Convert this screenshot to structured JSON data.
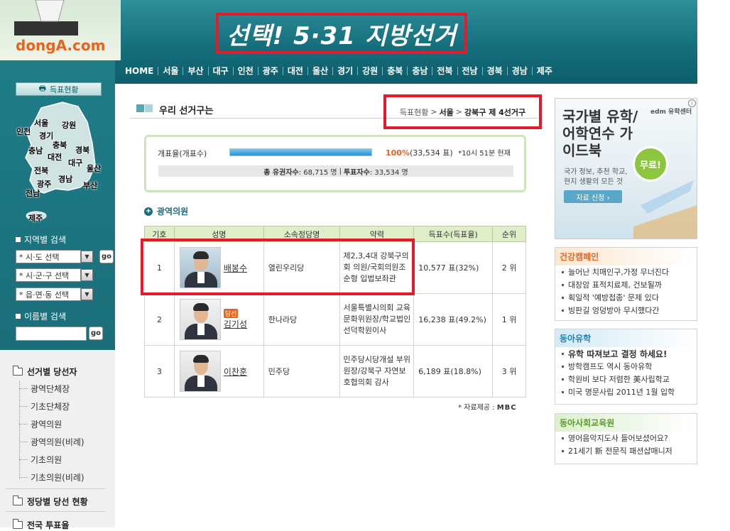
{
  "header": {
    "logo": "dongA.com",
    "banner": "선택! 5·31 지방선거",
    "nav": [
      "HOME",
      "서울",
      "부산",
      "대구",
      "인천",
      "광주",
      "대전",
      "울산",
      "경기",
      "강원",
      "충북",
      "충남",
      "전북",
      "전남",
      "경북",
      "경남",
      "제주"
    ]
  },
  "sidebar": {
    "vote_button": "득표현황",
    "map_regions": [
      "서울",
      "강원",
      "인천",
      "경기",
      "충북",
      "충남",
      "대전",
      "경북",
      "대구",
      "울산",
      "전북",
      "경남",
      "광주",
      "부산",
      "전남",
      "제주"
    ],
    "region_search_label": "지역별 검색",
    "selects": [
      "* 시·도 선택",
      "* 시·군·구 선택",
      "* 읍·면·동 선택"
    ],
    "go": "go",
    "name_search_label": "이름별 검색",
    "tree_title": "선거별 당선자",
    "tree_items": [
      "광역단체장",
      "기초단체장",
      "광역의원",
      "광역의원(비례)",
      "기초의원",
      "기초의원(비례)"
    ],
    "party_title": "정당별 당선 현황",
    "national_title": "전국 투표율"
  },
  "main": {
    "title": "우리 선거구는",
    "breadcrumb": {
      "root": "득표현황",
      "city": "서울",
      "district": "강북구 제 4선거구"
    },
    "summary": {
      "label": "개표율(개표수)",
      "progress": 1.0,
      "percent": "100%",
      "count": "(33,534 표)",
      "time": "*10시 51분 현재",
      "voters_label": "총 유권자수",
      "voters": ": 68,715 명",
      "turnout_label": "투표자수",
      "turnout": ": 33,534 명"
    },
    "section": "광역의원",
    "table": {
      "headers": [
        "기호",
        "성명",
        "소속정당명",
        "약력",
        "득표수(득표율)",
        "순위"
      ],
      "rows": [
        {
          "num": "1",
          "name": "배봉수",
          "badge": "",
          "party": "열린우리당",
          "career": "제2,3,4대 강북구의회 의원/국회의원조순형 입법보좌관",
          "votes": "10,577 표(32%)",
          "rank": "2 위"
        },
        {
          "num": "2",
          "name": "김기성",
          "badge": "당선",
          "party": "한나라당",
          "career": "서울특별시의회 교육문화위원장/학교법인 선덕학원이사",
          "votes": "16,238 표(49.2%)",
          "rank": "1 위"
        },
        {
          "num": "3",
          "name": "이찬훈",
          "badge": "",
          "party": "민주당",
          "career": "민주당시당개설 부위원장/강북구 자연보호협의회 감사",
          "votes": "6,189 표(18.8%)",
          "rank": "3 위"
        }
      ]
    },
    "source_label": "* 자료제공 :",
    "source": "MBC"
  },
  "right": {
    "ad": {
      "title": "국가별 유학/어학연수 가이드북",
      "sub": "국가 정보, 추천 학교, 현지 생활의 모든 것",
      "button": "자료 신청 ›",
      "badge": "무료!",
      "logo": "edm 유학센터",
      "info": "i"
    },
    "boxes": [
      {
        "title": "건강캠페인",
        "color": "#e8641e",
        "items": [
          "늘어난 치매인구,가정 무너진다",
          "대장암 표적치료제, 건보될까",
          "획일적 '예방접종' 문제 있다",
          "빙판길 엉덩방아 무시했다간"
        ]
      },
      {
        "title": "동아유학",
        "color": "#1a7fb0",
        "items": [
          "유학 따져보고 결정 하세요!",
          "방학캠프도 역시 동아유학",
          "학원비 보다 저렴한 美사립학교",
          "미국 명문사립 2011년 1월 입학"
        ]
      },
      {
        "title": "동아사회교육원",
        "color": "#5a9a2c",
        "items": [
          "영어음악지도사 들어보셨어요?",
          "21세기 新 전문직 패션샵매니저"
        ]
      }
    ]
  },
  "colors": {
    "highlight": "#e21b2d",
    "teal": "#1a6e7a",
    "accent": "#e8641e"
  }
}
